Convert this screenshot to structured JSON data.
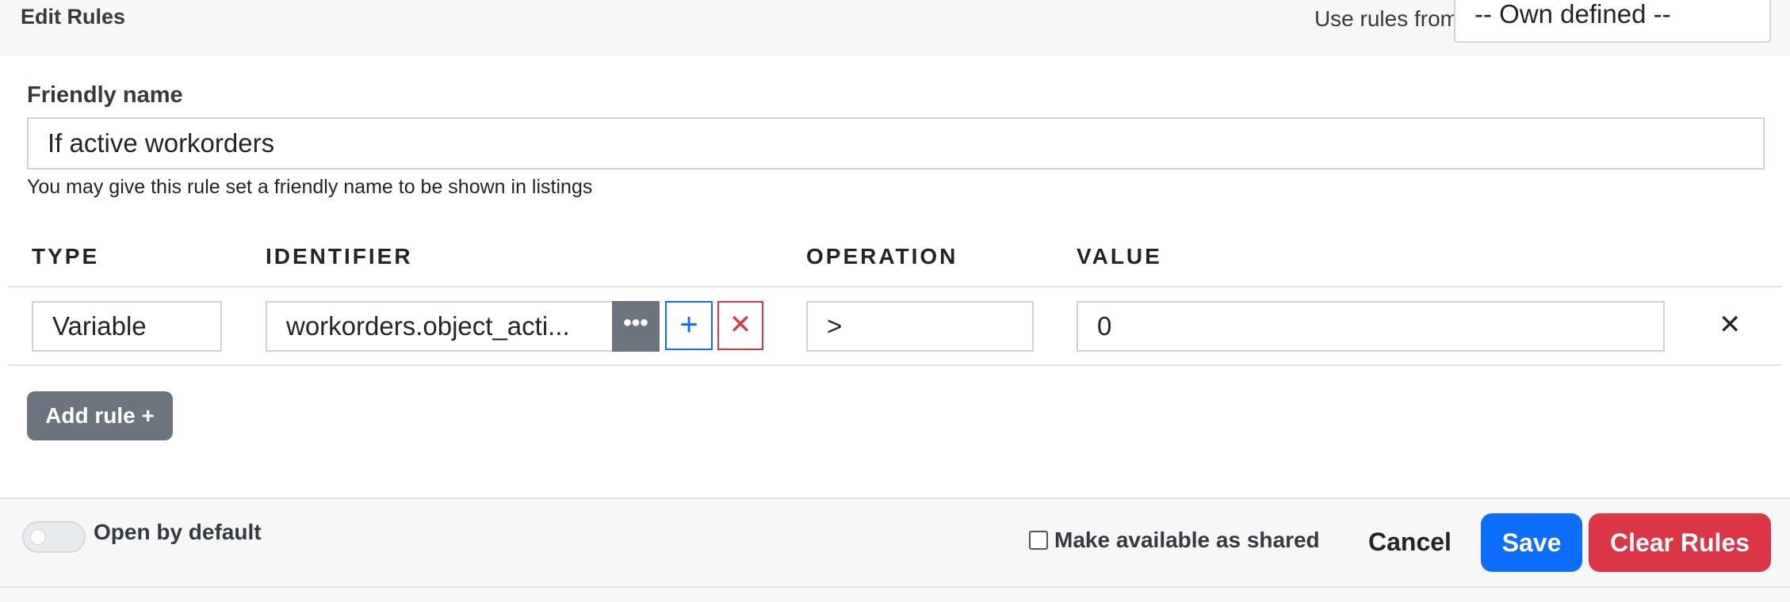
{
  "header": {
    "title": "Edit Rules",
    "use_rules_label": "Use rules from",
    "use_rules_selected": "-- Own defined --"
  },
  "friendly_name": {
    "label": "Friendly name",
    "value": "If active workorders",
    "help": "You may give this rule set a friendly name to be shown in listings"
  },
  "table": {
    "headers": [
      "TYPE",
      "IDENTIFIER",
      "OPERATION",
      "VALUE"
    ],
    "rows": [
      {
        "type": "Variable",
        "identifier": "workorders.object_acti...",
        "operation": ">",
        "value": "0"
      }
    ],
    "icons": {
      "more": "ellipsis-icon",
      "add": "plus-icon",
      "clear": "x-icon",
      "remove": "close-icon"
    }
  },
  "add_rule": {
    "label": "Add rule +"
  },
  "footer": {
    "open_by_default_label": "Open by default",
    "open_by_default_on": false,
    "shared_label": "Make available as shared",
    "shared_checked": false,
    "cancel_label": "Cancel",
    "save_label": "Save",
    "clear_label": "Clear Rules"
  },
  "colors": {
    "primary": "#0d6efd",
    "danger": "#dc3545",
    "secondary": "#6c757d"
  }
}
